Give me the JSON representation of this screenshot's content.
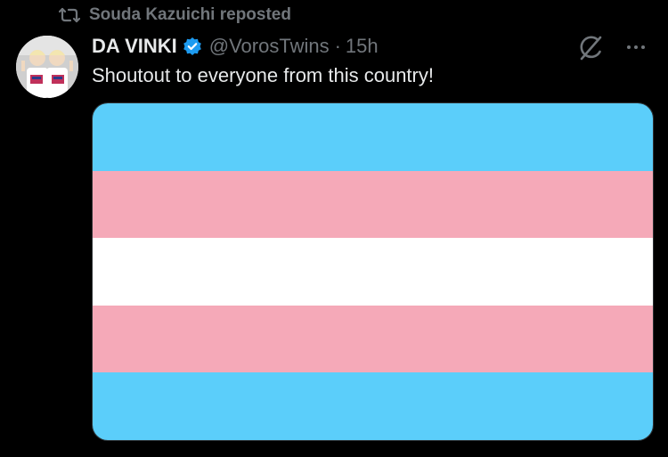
{
  "repost": {
    "label": "Souda Kazuichi reposted",
    "icon": "repost-icon"
  },
  "author": {
    "display_name": "DA VINKI",
    "handle": "@VorosTwins",
    "separator": "·",
    "timestamp": "15h",
    "verified": true
  },
  "tweet": {
    "text": "Shoutout to everyone from this country!"
  },
  "media": {
    "stripes": [
      "#5bcefa",
      "#f5a9b8",
      "#ffffff",
      "#f5a9b8",
      "#5bcefa"
    ]
  },
  "colors": {
    "verified": "#1d9bf0",
    "muted": "#71767b"
  }
}
